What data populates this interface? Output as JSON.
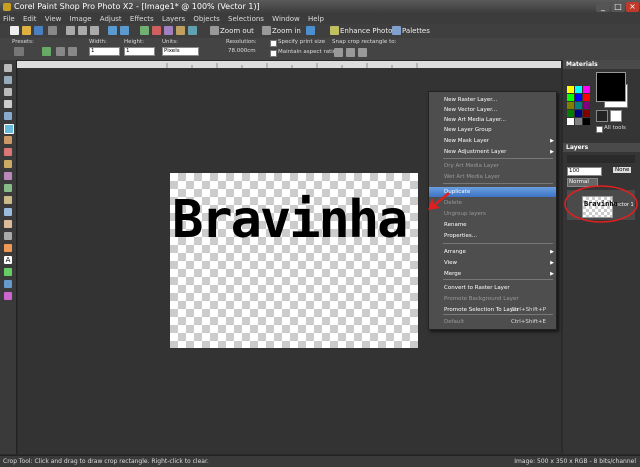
{
  "window": {
    "title": "Corel Paint Shop Pro Photo X2 - [Image1* @ 100% (Vector 1)]"
  },
  "menubar": [
    "File",
    "Edit",
    "View",
    "Image",
    "Adjust",
    "Effects",
    "Layers",
    "Objects",
    "Selections",
    "Window",
    "Help"
  ],
  "toolbar": {
    "zoom_out": "Zoom out",
    "zoom_in": "Zoom in",
    "enhance_photo": "Enhance Photo",
    "palettes": "Palettes"
  },
  "options": {
    "presets_label": "Presets:",
    "width_label": "Width:",
    "width_value": "1",
    "height_label": "Height:",
    "height_value": "1",
    "units_label": "Units:",
    "units_value": "Pixels",
    "resolution_label": "Resolution:",
    "resolution_value": "78.000cm",
    "specify_print_size": "Specify print size",
    "maintain_aspect_ratio": "Maintain aspect ratio",
    "snap_crop_label": "Snap crop rectangle to:"
  },
  "canvas": {
    "text": "Bravinha"
  },
  "context_menu": [
    {
      "label": "New Raster Layer...",
      "disabled": false
    },
    {
      "label": "New Vector Layer...",
      "disabled": false
    },
    {
      "label": "New Art Media Layer...",
      "disabled": false
    },
    {
      "label": "New Layer Group",
      "disabled": false
    },
    {
      "label": "New Mask Layer",
      "disabled": false,
      "submenu": true
    },
    {
      "label": "New Adjustment Layer",
      "disabled": false,
      "submenu": true
    },
    {
      "label": "Dry Art Media Layer",
      "disabled": true
    },
    {
      "label": "Wet Art Media Layer",
      "disabled": true
    },
    {
      "label": "Duplicate",
      "disabled": false,
      "highlighted": true
    },
    {
      "label": "Delete",
      "disabled": true
    },
    {
      "label": "Ungroup layers",
      "disabled": true
    },
    {
      "label": "Rename",
      "disabled": false
    },
    {
      "label": "Properties...",
      "disabled": false
    },
    {
      "label": "Arrange",
      "disabled": false,
      "submenu": true
    },
    {
      "label": "View",
      "disabled": false,
      "submenu": true
    },
    {
      "label": "Merge",
      "disabled": false,
      "submenu": true
    },
    {
      "label": "Convert to Raster Layer",
      "disabled": false
    },
    {
      "label": "Promote Background Layer",
      "disabled": true
    },
    {
      "label": "Promote Selection To Layer",
      "disabled": false,
      "shortcut": "Ctrl+Shift+P"
    },
    {
      "label": "Default",
      "disabled": true,
      "shortcut": "Ctrl+Shift+E"
    }
  ],
  "materials": {
    "title": "Materials",
    "all_tools": "All tools"
  },
  "layers": {
    "title": "Layers",
    "opacity": "100",
    "blend_mode": "Normal",
    "none_label": "None",
    "layer_name": "Vector 1",
    "thumb_text": "Bravinha"
  },
  "status": {
    "left": "Crop Tool: Click and drag to draw crop rectangle. Right-click to clear.",
    "right": "Image:  500 x 350 x RGB - 8 bits/channel"
  },
  "colors": {
    "accent": "#3d73c4",
    "annotation": "#e02020"
  },
  "icons": [
    "app-icon",
    "new-icon",
    "open-icon",
    "save-icon",
    "zoom-out-icon",
    "zoom-in-icon",
    "crop-tool-icon",
    "arrow-right-icon",
    "close-icon"
  ]
}
